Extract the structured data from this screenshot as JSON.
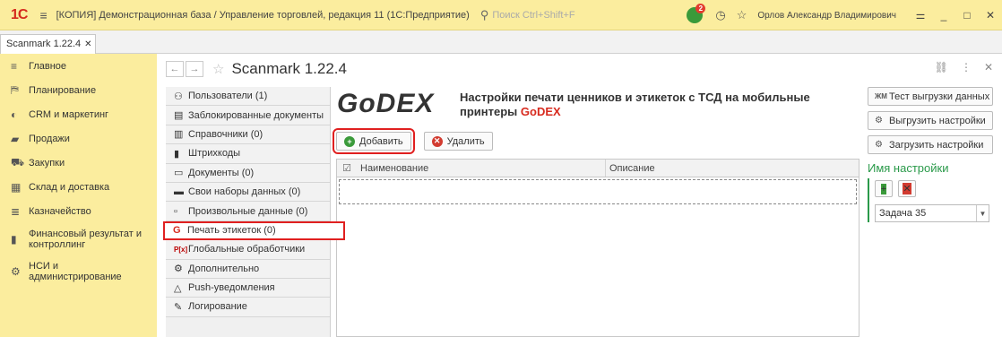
{
  "titlebar": {
    "logo": "1С",
    "title": "[КОПИЯ] Демонстрационная база / Управление торговлей, редакция 11  (1С:Предприятие)",
    "search_placeholder": "Поиск Ctrl+Shift+F",
    "notifications_count": "2",
    "user": "Орлов Александр Владимирович"
  },
  "tabs": [
    {
      "label": "Scanmark 1.22.4"
    }
  ],
  "nav": {
    "items": [
      {
        "label": "Главное",
        "icon": "menu-icon"
      },
      {
        "label": "Планирование",
        "icon": "planning-icon"
      },
      {
        "label": "CRM и маркетинг",
        "icon": "crm-icon"
      },
      {
        "label": "Продажи",
        "icon": "sales-icon"
      },
      {
        "label": "Закупки",
        "icon": "cart-icon"
      },
      {
        "label": "Склад и доставка",
        "icon": "warehouse-icon"
      },
      {
        "label": "Казначейство",
        "icon": "treasury-icon"
      },
      {
        "label": "Финансовый результат и контроллинг",
        "icon": "chart-icon"
      },
      {
        "label": "НСИ и администрирование",
        "icon": "gear-icon"
      }
    ]
  },
  "form": {
    "title": "Scanmark 1.22.4",
    "left_items": [
      {
        "label": "Пользователи (1)"
      },
      {
        "label": "Заблокированные документы"
      },
      {
        "label": "Справочники (0)"
      },
      {
        "label": "Штрихкоды"
      },
      {
        "label": "Документы (0)"
      },
      {
        "label": "Свои наборы данных (0)"
      },
      {
        "label": "Произвольные данные (0)"
      },
      {
        "label": "Печать этикеток (0)"
      },
      {
        "label": "Глобальные обработчики"
      },
      {
        "label": "Дополнительно"
      },
      {
        "label": "Push-уведомления"
      },
      {
        "label": "Логирование"
      }
    ],
    "center": {
      "logo": "GoDEX",
      "title_main": "Настройки печати ценников и этикеток с ТСД на мобильные принтеры",
      "title_brand": "GoDEX",
      "add_label": "Добавить",
      "delete_label": "Удалить",
      "col_name": "Наименование",
      "col_desc": "Описание"
    },
    "right": {
      "test_export_label": "Тест выгрузки данных",
      "export_settings_label": "Выгрузить настройки",
      "import_settings_label": "Загрузить настройки",
      "settings_name_label": "Имя настройки",
      "task_value": "Задача 35"
    }
  },
  "colors": {
    "accent_yellow": "#fbed9e",
    "highlight_red": "#e02020",
    "brand_red": "#d72a1e",
    "green": "#2a9a4a"
  }
}
